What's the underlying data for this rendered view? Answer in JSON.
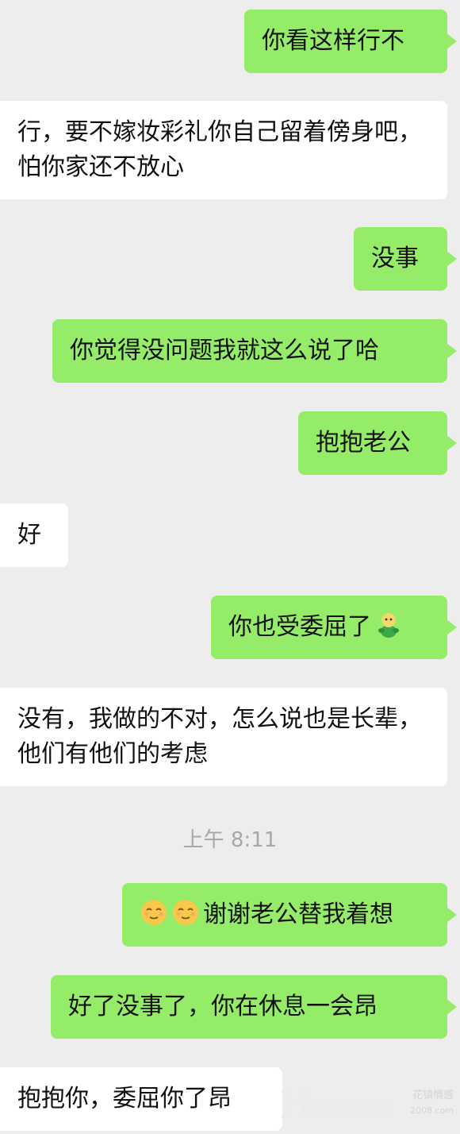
{
  "messages": [
    {
      "side": "sent",
      "text": "你看这样行不"
    },
    {
      "side": "recv",
      "text": "行，要不嫁妆彩礼你自己留着傍身吧，怕你家还不放心"
    },
    {
      "side": "sent",
      "text": "没事"
    },
    {
      "side": "sent",
      "text": "你觉得没问题我就这么说了哈"
    },
    {
      "side": "sent",
      "text": "抱抱老公"
    },
    {
      "side": "recv",
      "text": "好"
    },
    {
      "side": "sent",
      "text": "你也受委屈了",
      "emoji_after": "green-bean-figure-emoji"
    },
    {
      "side": "recv",
      "text": "没有，我做的不对，怎么说也是长辈，他们有他们的考虑"
    },
    {
      "side": "sent",
      "text": "谢谢老公替我着想",
      "emoji_before": [
        "relieved-face-emoji",
        "relieved-face-emoji"
      ]
    },
    {
      "side": "sent",
      "text": "好了没事了，你在休息一会昂"
    },
    {
      "side": "recv",
      "text": "抱抱你，委屈你了昂"
    }
  ],
  "timestamp": "上午 8:11",
  "watermark": {
    "brand_initial": "H",
    "brand": "uazhen",
    "brand_cn": "花镇情感",
    "url": "2008.com"
  },
  "colors": {
    "background": "#ededed",
    "sent_bubble": "#95ec69",
    "received_bubble": "#ffffff",
    "timestamp": "#a8a8a8"
  }
}
